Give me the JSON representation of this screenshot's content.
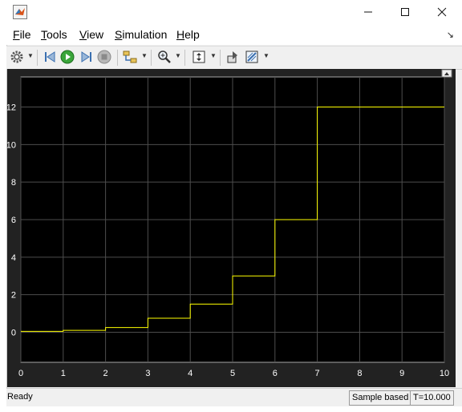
{
  "menu": {
    "items": [
      {
        "label": "File",
        "key": "F",
        "rest": "ile"
      },
      {
        "label": "Tools",
        "key": "T",
        "rest": "ools"
      },
      {
        "label": "View",
        "key": "V",
        "rest": "iew"
      },
      {
        "label": "Simulation",
        "key": "S",
        "rest": "imulation"
      },
      {
        "label": "Help",
        "key": "H",
        "rest": "elp"
      }
    ]
  },
  "toolbar": {
    "icons": [
      "gear-icon",
      "step-back-icon",
      "run-icon",
      "step-forward-icon",
      "stop-icon",
      "signal-select-icon",
      "zoom-icon",
      "autoscale-icon",
      "highlight-block-icon",
      "style-icon"
    ]
  },
  "status": {
    "ready": "Ready",
    "mode": "Sample based",
    "time": "T=10.000"
  },
  "chart_data": {
    "type": "line",
    "xlim": [
      0,
      10
    ],
    "ylim": [
      -1.6,
      13.6
    ],
    "xticks": [
      "0",
      "1",
      "2",
      "3",
      "4",
      "5",
      "6",
      "7",
      "8",
      "9",
      "10"
    ],
    "yticks": [
      "0",
      "2",
      "4",
      "6",
      "8",
      "10",
      "12"
    ],
    "grid": true,
    "step": true,
    "series": [
      {
        "color": "#ffff00",
        "points": [
          [
            0,
            0.05
          ],
          [
            1,
            0.1
          ],
          [
            2,
            0.25
          ],
          [
            3,
            0.75
          ],
          [
            4,
            1.5
          ],
          [
            5,
            3
          ],
          [
            6,
            6
          ],
          [
            7,
            12
          ],
          [
            10,
            12
          ]
        ]
      }
    ]
  }
}
